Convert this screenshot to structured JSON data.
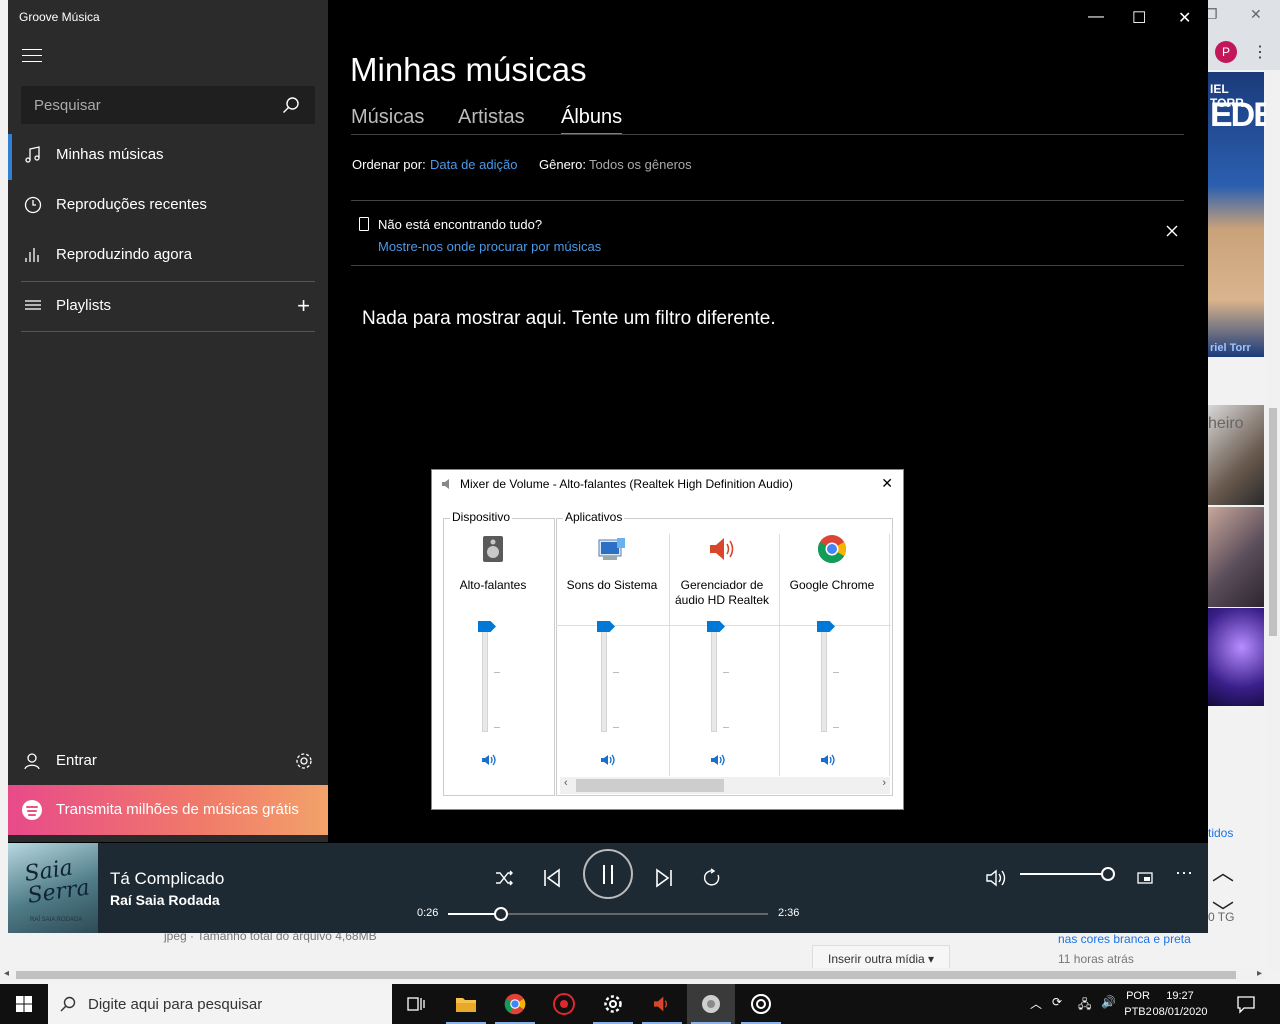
{
  "background": {
    "avatar_letter": "P",
    "book_line1": "IEL TORR",
    "book_line2": "EDES",
    "book_line3": "riel Torr",
    "partial_text": "heiro",
    "link_partial": "tidos",
    "tg_partial": "0 TG",
    "news_title": "nas cores branca e preta",
    "news_time": "11 horas atrás",
    "file_info": "jpeg · Tamanho total do arquivo 4,68MB",
    "insert_media_label": "Inserir outra mídia ▾"
  },
  "groove": {
    "app_title": "Groove Música",
    "search_placeholder": "Pesquisar",
    "nav": [
      {
        "label": "Minhas músicas",
        "icon": "music-note-icon"
      },
      {
        "label": "Reproduções recentes",
        "icon": "clock-icon"
      },
      {
        "label": "Reproduzindo agora",
        "icon": "equalizer-icon"
      },
      {
        "label": "Playlists",
        "icon": "playlist-icon"
      }
    ],
    "signin_label": "Entrar",
    "spotify_label": "Transmita milhões de músicas grátis",
    "heading": "Minhas músicas",
    "tabs": [
      {
        "label": "Músicas"
      },
      {
        "label": "Artistas"
      },
      {
        "label": "Álbuns"
      }
    ],
    "sort_label": "Ordenar por:",
    "sort_value": "Data de adição",
    "genre_label": "Gênero:",
    "genre_value": "Todos os gêneros",
    "notice_title": "Não está encontrando tudo?",
    "notice_link": "Mostre-nos onde procurar por músicas",
    "empty_message": "Nada para mostrar aqui. Tente um filtro diferente.",
    "player": {
      "cover_text": "Saia Serra",
      "cover_subtext": "RAÍ SAIA RODADA",
      "song_title": "Tá Complicado",
      "artist": "Raí Saia Rodada",
      "elapsed": "0:26",
      "duration": "2:36",
      "progress": 0.167,
      "volume": 1.0
    }
  },
  "mixer": {
    "title": "Mixer de Volume - Alto-falantes (Realtek High Definition Audio)",
    "device_group": "Dispositivo",
    "apps_group": "Aplicativos",
    "channels": [
      {
        "name": "Alto-falantes",
        "icon": "speaker-device-icon",
        "level": 1.0
      },
      {
        "name": "Sons do Sistema",
        "icon": "system-sounds-icon",
        "level": 1.0
      },
      {
        "name": "Gerenciador de áudio HD Realtek",
        "icon": "realtek-speaker-icon",
        "level": 1.0
      },
      {
        "name": "Google Chrome",
        "icon": "chrome-icon",
        "level": 1.0
      }
    ]
  },
  "taskbar": {
    "search_placeholder": "Digite aqui para pesquisar",
    "lang_line1": "POR",
    "lang_line2": "PTB2",
    "time": "19:27",
    "date": "08/01/2020"
  }
}
